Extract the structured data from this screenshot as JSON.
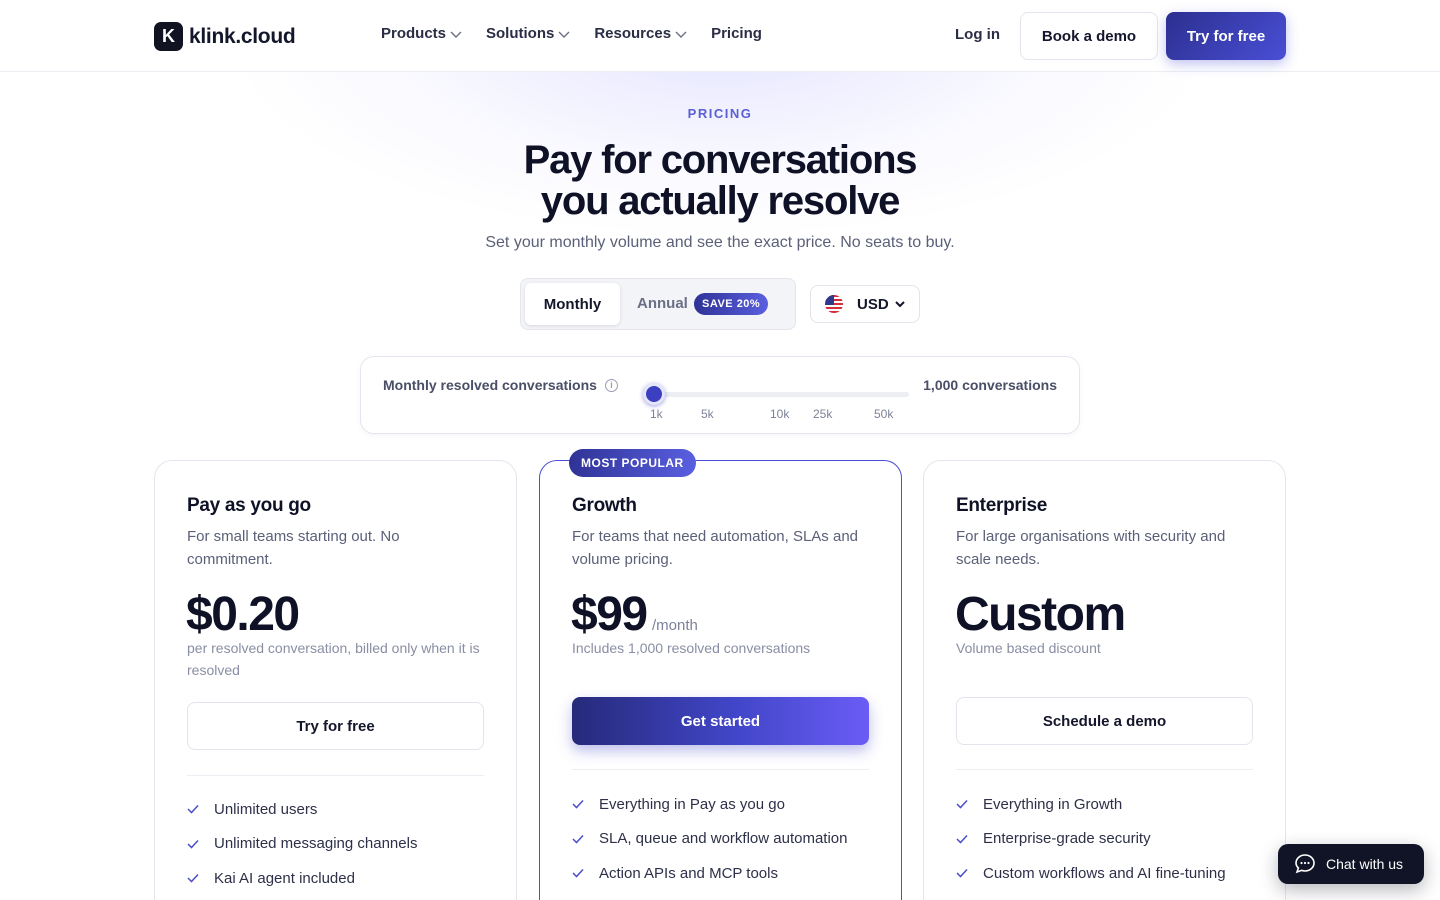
{
  "brand": {
    "logo_letter": "K",
    "name": "klink.cloud"
  },
  "nav": {
    "items": [
      {
        "label": "Products",
        "has_dropdown": true
      },
      {
        "label": "Solutions",
        "has_dropdown": true
      },
      {
        "label": "Resources",
        "has_dropdown": true
      },
      {
        "label": "Pricing",
        "has_dropdown": false
      }
    ],
    "login": "Log in",
    "book_demo": "Book a demo",
    "try_free": "Try for free"
  },
  "hero": {
    "eyebrow": "PRICING",
    "title_line1": "Pay for conversations",
    "title_line2": "you actually resolve",
    "subtitle": "Set your monthly volume and see the exact price. No seats to buy."
  },
  "billing": {
    "monthly": "Monthly",
    "annual": "Annual",
    "save_badge": "SAVE 20%",
    "selected": "Monthly"
  },
  "currency": {
    "selected": "USD",
    "flag_icon": "us-flag-icon"
  },
  "slider": {
    "label": "Monthly resolved conversations",
    "value_text": "1,000 conversations",
    "ticks": [
      "1k",
      "5k",
      "10k",
      "25k",
      "50k"
    ],
    "position": 0.0
  },
  "plans": [
    {
      "name": "Pay as you go",
      "description": "For small teams starting out. No commitment.",
      "price": "$0.20",
      "period": "",
      "note": "per resolved conversation, billed only when it is resolved",
      "cta": "Try for free",
      "features": [
        "Unlimited users",
        "Unlimited messaging channels",
        "Kai AI agent included"
      ]
    },
    {
      "name": "Growth",
      "badge": "MOST POPULAR",
      "description": "For teams that need automation, SLAs and volume pricing.",
      "price": "$99",
      "period": "/month",
      "note": "Includes 1,000 resolved conversations",
      "cta": "Get started",
      "features": [
        "Everything in Pay as you go",
        "SLA, queue and workflow automation",
        "Action APIs and MCP tools"
      ]
    },
    {
      "name": "Enterprise",
      "description": "For large organisations with security and scale needs.",
      "price": "Custom",
      "period": "",
      "note": "Volume based discount",
      "cta": "Schedule a demo",
      "features": [
        "Everything in Growth",
        "Enterprise-grade security",
        "Custom workflows and AI fine-tuning"
      ]
    }
  ],
  "chat": {
    "label": "Chat with us"
  },
  "colors": {
    "accent": "#4a4fd6",
    "dark": "#0f1226",
    "muted": "#5b6078"
  }
}
